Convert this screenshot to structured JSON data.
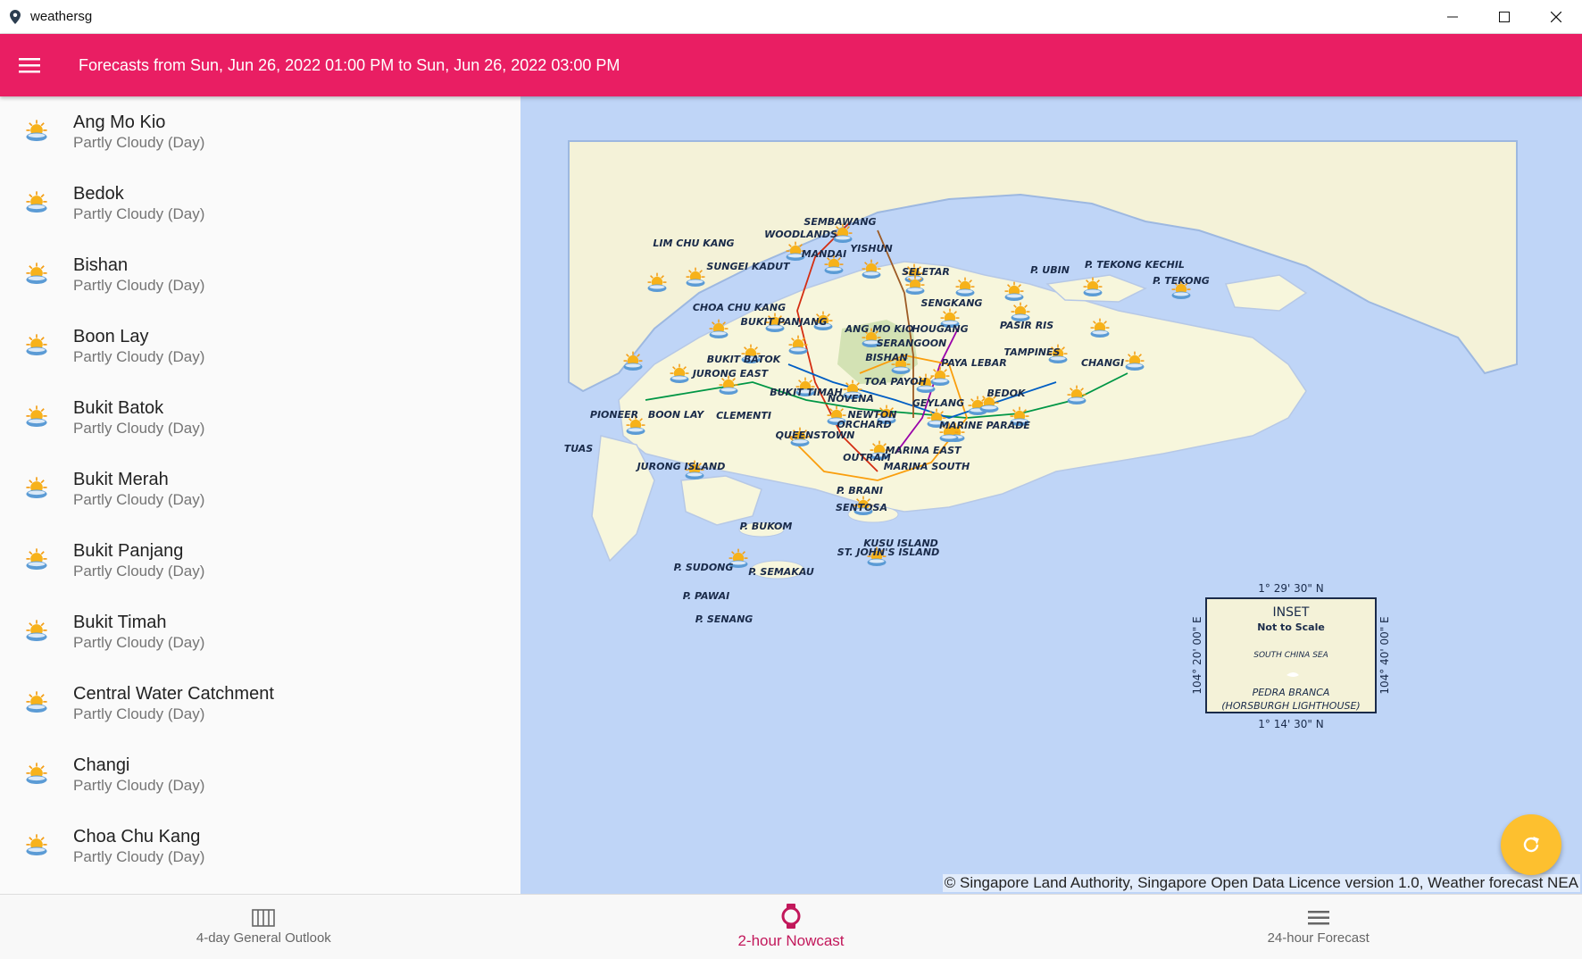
{
  "window": {
    "title": "weathersg",
    "controls": [
      "minimize",
      "maximize",
      "close"
    ]
  },
  "appbar": {
    "menu_icon": "hamburger-menu-icon",
    "title": "Forecasts from Sun, Jun 26, 2022 01:00 PM to Sun, Jun 26, 2022 03:00 PM",
    "color": "#e91e63"
  },
  "areas": [
    {
      "name": "Ang Mo Kio",
      "forecast": "Partly Cloudy (Day)",
      "icon": "partly-cloudy-day-icon"
    },
    {
      "name": "Bedok",
      "forecast": "Partly Cloudy (Day)",
      "icon": "partly-cloudy-day-icon"
    },
    {
      "name": "Bishan",
      "forecast": "Partly Cloudy (Day)",
      "icon": "partly-cloudy-day-icon"
    },
    {
      "name": "Boon Lay",
      "forecast": "Partly Cloudy (Day)",
      "icon": "partly-cloudy-day-icon"
    },
    {
      "name": "Bukit Batok",
      "forecast": "Partly Cloudy (Day)",
      "icon": "partly-cloudy-day-icon"
    },
    {
      "name": "Bukit Merah",
      "forecast": "Partly Cloudy (Day)",
      "icon": "partly-cloudy-day-icon"
    },
    {
      "name": "Bukit Panjang",
      "forecast": "Partly Cloudy (Day)",
      "icon": "partly-cloudy-day-icon"
    },
    {
      "name": "Bukit Timah",
      "forecast": "Partly Cloudy (Day)",
      "icon": "partly-cloudy-day-icon"
    },
    {
      "name": "Central Water Catchment",
      "forecast": "Partly Cloudy (Day)",
      "icon": "partly-cloudy-day-icon"
    },
    {
      "name": "Changi",
      "forecast": "Partly Cloudy (Day)",
      "icon": "partly-cloudy-day-icon"
    },
    {
      "name": "Choa Chu Kang",
      "forecast": "Partly Cloudy (Day)",
      "icon": "partly-cloudy-day-icon"
    }
  ],
  "map": {
    "labels": [
      "SEMBAWANG",
      "WOODLANDS",
      "YISHUN",
      "LIM CHU KANG",
      "MANDAI",
      "SUNGEI KADUT",
      "SELETAR",
      "P. UBIN",
      "P. TEKONG KECHIL",
      "P. TEKONG",
      "SENGKANG",
      "CHOA CHU KANG",
      "BUKIT PANJANG",
      "ANG MO KIO",
      "HOUGANG",
      "PASIR RIS",
      "SERANGOON",
      "BUKIT BATOK",
      "BISHAN",
      "PAYA LEBAR",
      "TAMPINES",
      "CHANGI",
      "JURONG EAST",
      "TOA PAYOH",
      "BUKIT TIMAH",
      "BEDOK",
      "NOVENA",
      "GEYLANG",
      "PIONEER",
      "BOON LAY",
      "CLEMENTI",
      "NEWTON",
      "ORCHARD",
      "MARINE PARADE",
      "TUAS",
      "QUEENSTOWN",
      "MARINA EAST",
      "OUTRAM",
      "JURONG ISLAND",
      "MARINA SOUTH",
      "P. BRANI",
      "SENTOSA",
      "P. BUKOM",
      "KUSU ISLAND",
      "ST. JOHN'S ISLAND",
      "P. SUDONG",
      "P. SEMAKAU",
      "P. PAWAI",
      "P. SENANG"
    ],
    "inset": {
      "title": "INSET",
      "subtitle": "Not to Scale",
      "sea": "SOUTH CHINA SEA",
      "place": "PEDRA BRANCA",
      "place_sub": "(HORSBURGH LIGHTHOUSE)",
      "lat_top": "1° 29' 30\" N",
      "lat_bottom": "1° 14' 30\" N",
      "lon_left": "104° 20' 00\" E",
      "lon_right": "104° 40' 00\" E"
    },
    "attribution": "© Singapore Land Authority, Singapore Open Data Licence version 1.0, Weather forecast NEA"
  },
  "fab": {
    "icon": "refresh-icon",
    "color": "#fdc02f"
  },
  "bottom_nav": [
    {
      "label": "4-day General Outlook",
      "icon": "calendar-grid-icon",
      "active": false
    },
    {
      "label": "2-hour Nowcast",
      "icon": "watch-icon",
      "active": true
    },
    {
      "label": "24-hour Forecast",
      "icon": "list-lines-icon",
      "active": false
    }
  ]
}
